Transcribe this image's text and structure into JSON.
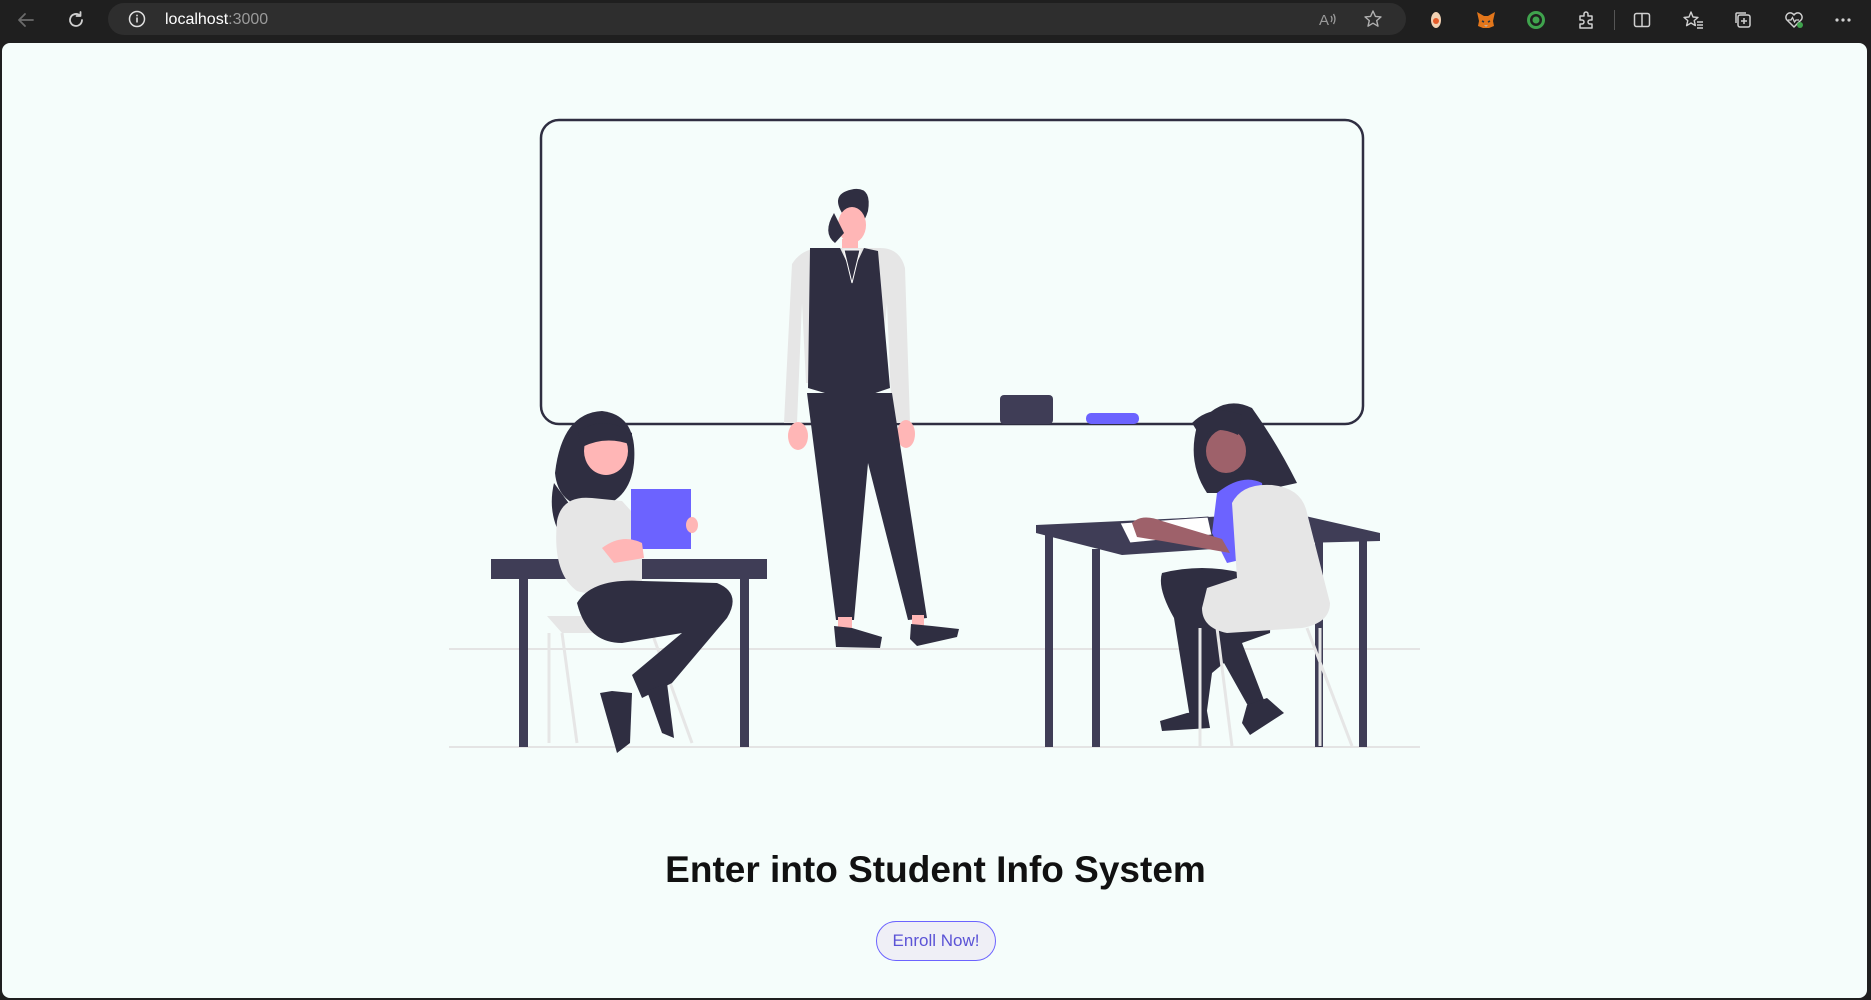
{
  "browser": {
    "url_host": "localhost",
    "url_port": ":3000",
    "icons": {
      "back": "back-arrow-icon",
      "refresh": "refresh-icon",
      "site_info": "info-icon",
      "read_aloud": "read-aloud-icon",
      "favorite": "star-icon",
      "extensions": [
        "extension-icon",
        "metamask-fox-icon",
        "target-icon",
        "puzzle-icon"
      ],
      "split_screen": "split-screen-icon",
      "favorites": "favorites-icon",
      "collections": "collections-icon",
      "browser_essentials": "heart-pulse-icon",
      "menu": "more-icon"
    }
  },
  "page": {
    "title": "Enter into Student Info System",
    "enroll_button_label": "Enroll Now!"
  },
  "colors": {
    "page_background": "#f5fdfb",
    "accent": "#6c63ff",
    "dark": "#2f2e41",
    "skin": "#ffb6b6",
    "shirt": "#e6e6e6"
  }
}
